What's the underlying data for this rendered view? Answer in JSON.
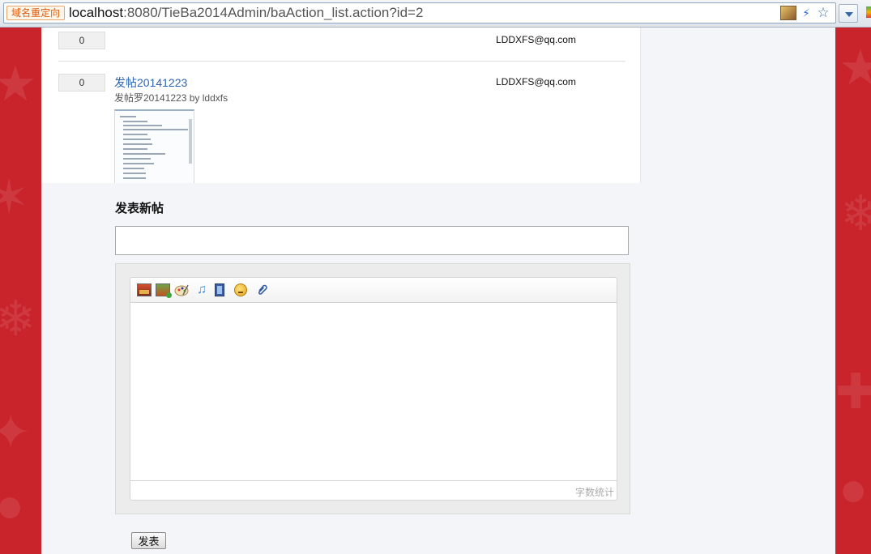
{
  "browser": {
    "redirect_badge": "域名重定向",
    "url_host": "localhost",
    "url_path": ":8080/TieBa2014Admin/baAction_list.action?id=2"
  },
  "posts": [
    {
      "reply_count": "0",
      "title": "",
      "subtitle": "",
      "email": "LDDXFS@qq.com"
    },
    {
      "reply_count": "0",
      "title": "发帖20141223",
      "subtitle": "发帖罗20141223 by lddxfs",
      "email": "LDDXFS@qq.com"
    }
  ],
  "new_post": {
    "heading": "发表新帖",
    "title_value": "",
    "editor": {
      "toolbar": [
        "image-icon",
        "multi-image-icon",
        "scrawl-icon",
        "music-icon",
        "video-icon",
        "emotion-icon",
        "attachment-icon"
      ],
      "word_count_label": "字数统计"
    },
    "submit_label": "发表"
  }
}
